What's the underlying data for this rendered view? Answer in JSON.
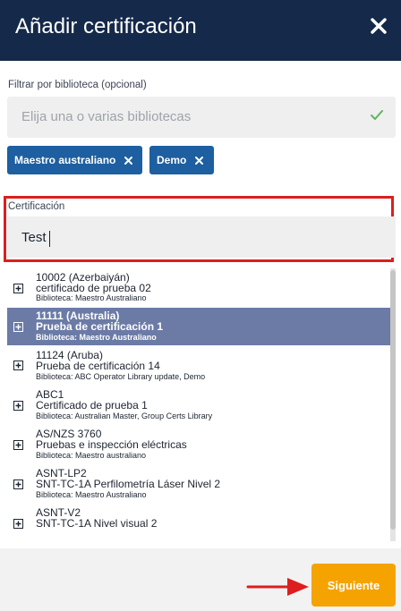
{
  "dialog": {
    "title": "Añadir certificación",
    "close_icon": "close-icon"
  },
  "library_filter": {
    "label": "Filtrar por biblioteca (opcional)",
    "placeholder": "Elija una o varias bibliotecas",
    "chips": [
      "Maestro australiano",
      "Demo"
    ]
  },
  "certification": {
    "label": "Certificación",
    "value": "Test"
  },
  "results": [
    {
      "code": "10002 (Azerbaiyán)",
      "name": "certificado de prueba 02",
      "library": "Biblioteca: Maestro Australiano",
      "selected": false
    },
    {
      "code": "11111 (Australia)",
      "name": "Prueba de certificación 1",
      "library": "Biblioteca: Maestro Australiano",
      "selected": true
    },
    {
      "code": "11124 (Aruba)",
      "name": "Prueba de certificación 14",
      "library": "Biblioteca: ABC Operator Library update, Demo",
      "selected": false
    },
    {
      "code": "ABC1",
      "name": "Certificado de prueba 1",
      "library": "Biblioteca: Australian Master, Group Certs Library",
      "selected": false
    },
    {
      "code": "AS/NZS 3760",
      "name": "Pruebas e inspección eléctricas",
      "library": "Biblioteca: Maestro australiano",
      "selected": false
    },
    {
      "code": "ASNT-LP2",
      "name": "SNT-TC-1A Perfilometría Láser Nivel 2",
      "library": "Biblioteca: Maestro Australiano",
      "selected": false
    },
    {
      "code": "ASNT-V2",
      "name": "SNT-TC-1A Nivel visual 2",
      "library": "",
      "selected": false
    }
  ],
  "footer": {
    "next_label": "Siguiente"
  },
  "colors": {
    "header": "#15294a",
    "chip": "#1d5fa0",
    "selected_row": "#6b7ba6",
    "highlight_frame": "#dd1e1e",
    "next_button": "#f5a300",
    "check": "#5cb85c"
  }
}
